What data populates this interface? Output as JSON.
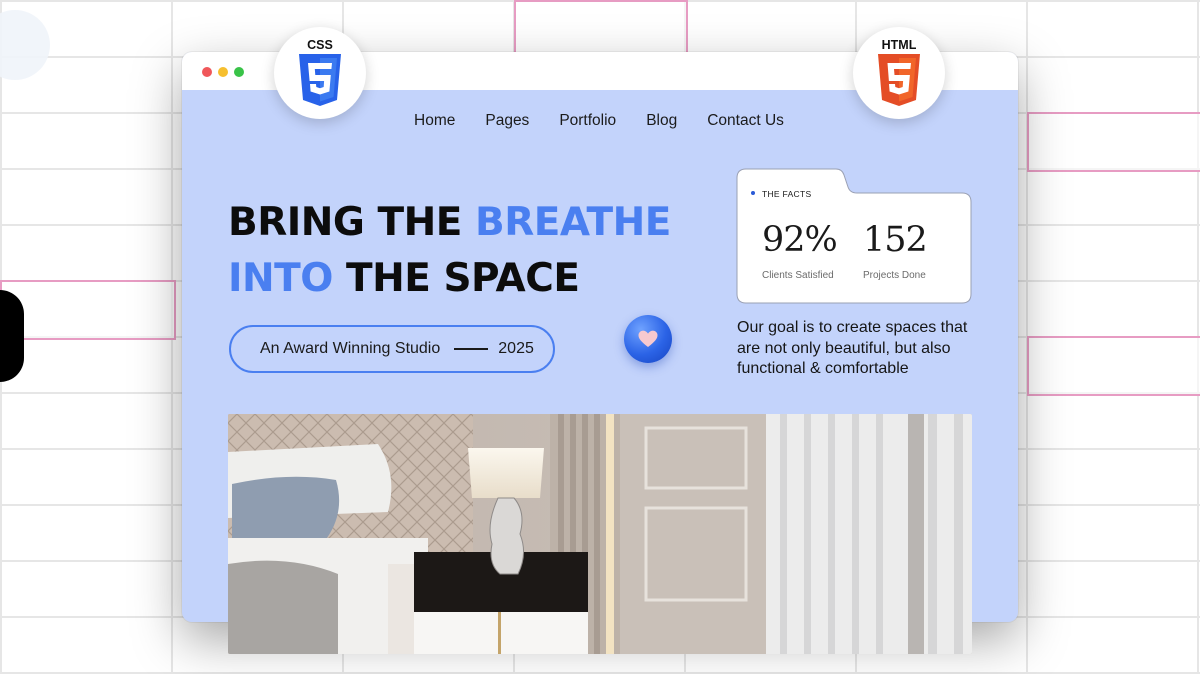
{
  "badges": {
    "css_label": "CSS",
    "html_label": "HTML",
    "css_color": "#2862e9",
    "html_color": "#e44d26"
  },
  "nav": {
    "items": [
      "Home",
      "Pages",
      "Portfolio",
      "Blog",
      "Contact Us"
    ]
  },
  "hero": {
    "line1_part1": "BRING THE ",
    "line1_accent": "BREATHE",
    "line2_accent": "INTO",
    "line2_part2": " THE SPACE",
    "accent_color": "#4a7ff0"
  },
  "award": {
    "label": "An Award Winning Studio",
    "year": "2025"
  },
  "facts": {
    "label": "THE FACTS",
    "stats": [
      {
        "value": "92%",
        "label": "Clients Satisfied"
      },
      {
        "value": "152",
        "label": "Projects Done"
      }
    ]
  },
  "goal": {
    "text": "Our goal is to create spaces that are not only beautiful, but also functional & comfortable"
  },
  "icons": [
    "heart-icon",
    "css3-logo-icon",
    "html5-logo-icon"
  ],
  "colors": {
    "page_bg": "#c3d3fb",
    "accent": "#4a7ff0"
  }
}
